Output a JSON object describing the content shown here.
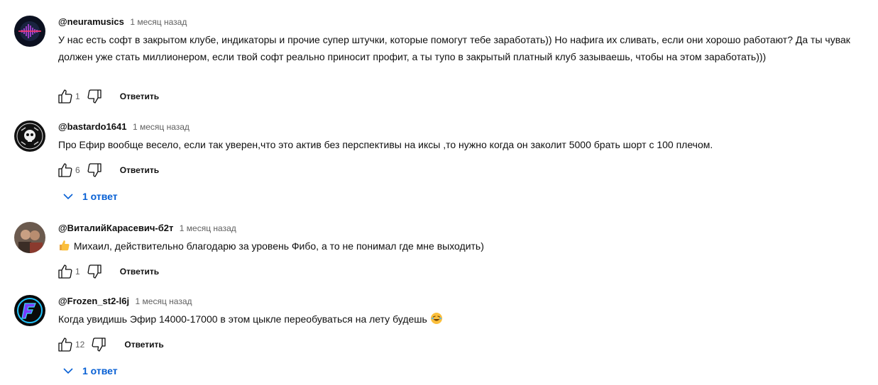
{
  "comments": [
    {
      "author": "@neuramusics",
      "time": "1 месяц назад",
      "text": "У нас есть софт в закрытом клубе, индикаторы и прочие супер штучки, которые помогут тебе заработать)) Но нафига их сливать, если они хорошо работают? Да ты чувак должен уже стать миллионером, если твой софт реально приносит профит, а ты тупо в закрытый платный клуб зазываешь, чтобы на этом заработать)))",
      "likes": "1",
      "reply_label": "Ответить",
      "avatar_icon": "sound-wave-avatar"
    },
    {
      "author": "@bastardo1641",
      "time": "1 месяц назад",
      "text": "Про Ефир вообще весело, если так уверен,что это актив без перспективы на иксы ,то нужно когда он заколит 5000 брать шорт с 100 плечом.",
      "likes": "6",
      "reply_label": "Ответить",
      "replies_label": "1 ответ",
      "avatar_icon": "skull-emblem-avatar"
    },
    {
      "author": "@ВиталийКарасевич-б2т",
      "time": "1 месяц назад",
      "text": "Михаил, действительно благодарю за уровень Фибо, а то не понимал где мне выходить)",
      "emoji": "thumbs-up-emoji",
      "likes": "1",
      "reply_label": "Ответить",
      "avatar_icon": "photo-avatar"
    },
    {
      "author": "@Frozen_st2-l6j",
      "time": "1 месяц назад",
      "text": "Когда увидишь Эфир 14000-17000 в этом цыкле переобуваться на лету будешь",
      "emoji": "laughing-emoji",
      "likes": "12",
      "reply_label": "Ответить",
      "replies_label": "1 ответ",
      "avatar_icon": "letter-f-avatar"
    }
  ],
  "colors": {
    "text": "#0f0f0f",
    "secondary": "#606060",
    "link": "#065fd4"
  }
}
